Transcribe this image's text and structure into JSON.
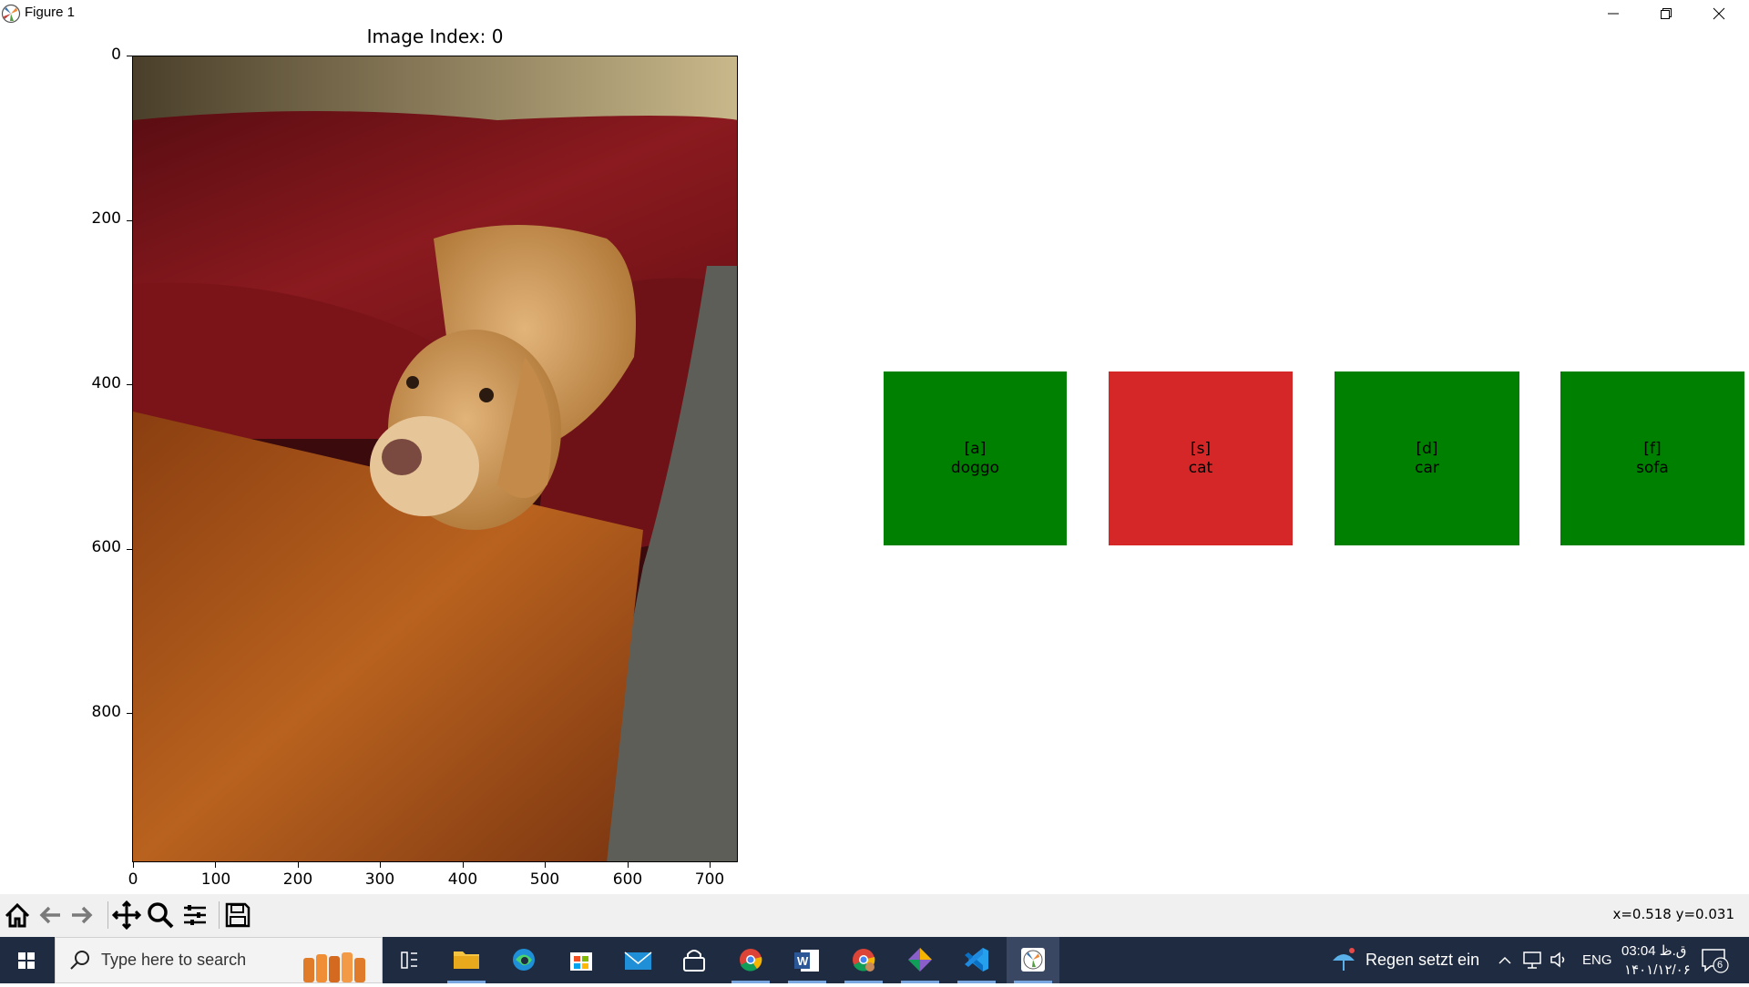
{
  "window": {
    "title": "Figure 1"
  },
  "figure": {
    "title": "Image Index: 0",
    "y_ticks": [
      "0",
      "200",
      "400",
      "600",
      "800"
    ],
    "x_ticks": [
      "0",
      "100",
      "200",
      "300",
      "400",
      "500",
      "600",
      "700"
    ]
  },
  "choices": [
    {
      "key": "[a]",
      "label": "doggo",
      "color": "#008000"
    },
    {
      "key": "[s]",
      "label": "cat",
      "color": "#d62728"
    },
    {
      "key": "[d]",
      "label": "car",
      "color": "#008000"
    },
    {
      "key": "[f]",
      "label": "sofa",
      "color": "#008000"
    }
  ],
  "toolbar": {
    "buttons": [
      "home-icon",
      "back-arrow-icon",
      "forward-arrow-icon",
      "pan-icon",
      "zoom-icon",
      "subplots-config-icon",
      "save-icon"
    ],
    "coords": "x=0.518 y=0.031"
  },
  "taskbar": {
    "search_placeholder": "Type here to search",
    "weather": "Regen setzt ein",
    "language": "ENG",
    "time": "03:04 ق.ظ",
    "date": "۱۴۰۱/۱۲/۰۶",
    "notification_count": "6"
  }
}
